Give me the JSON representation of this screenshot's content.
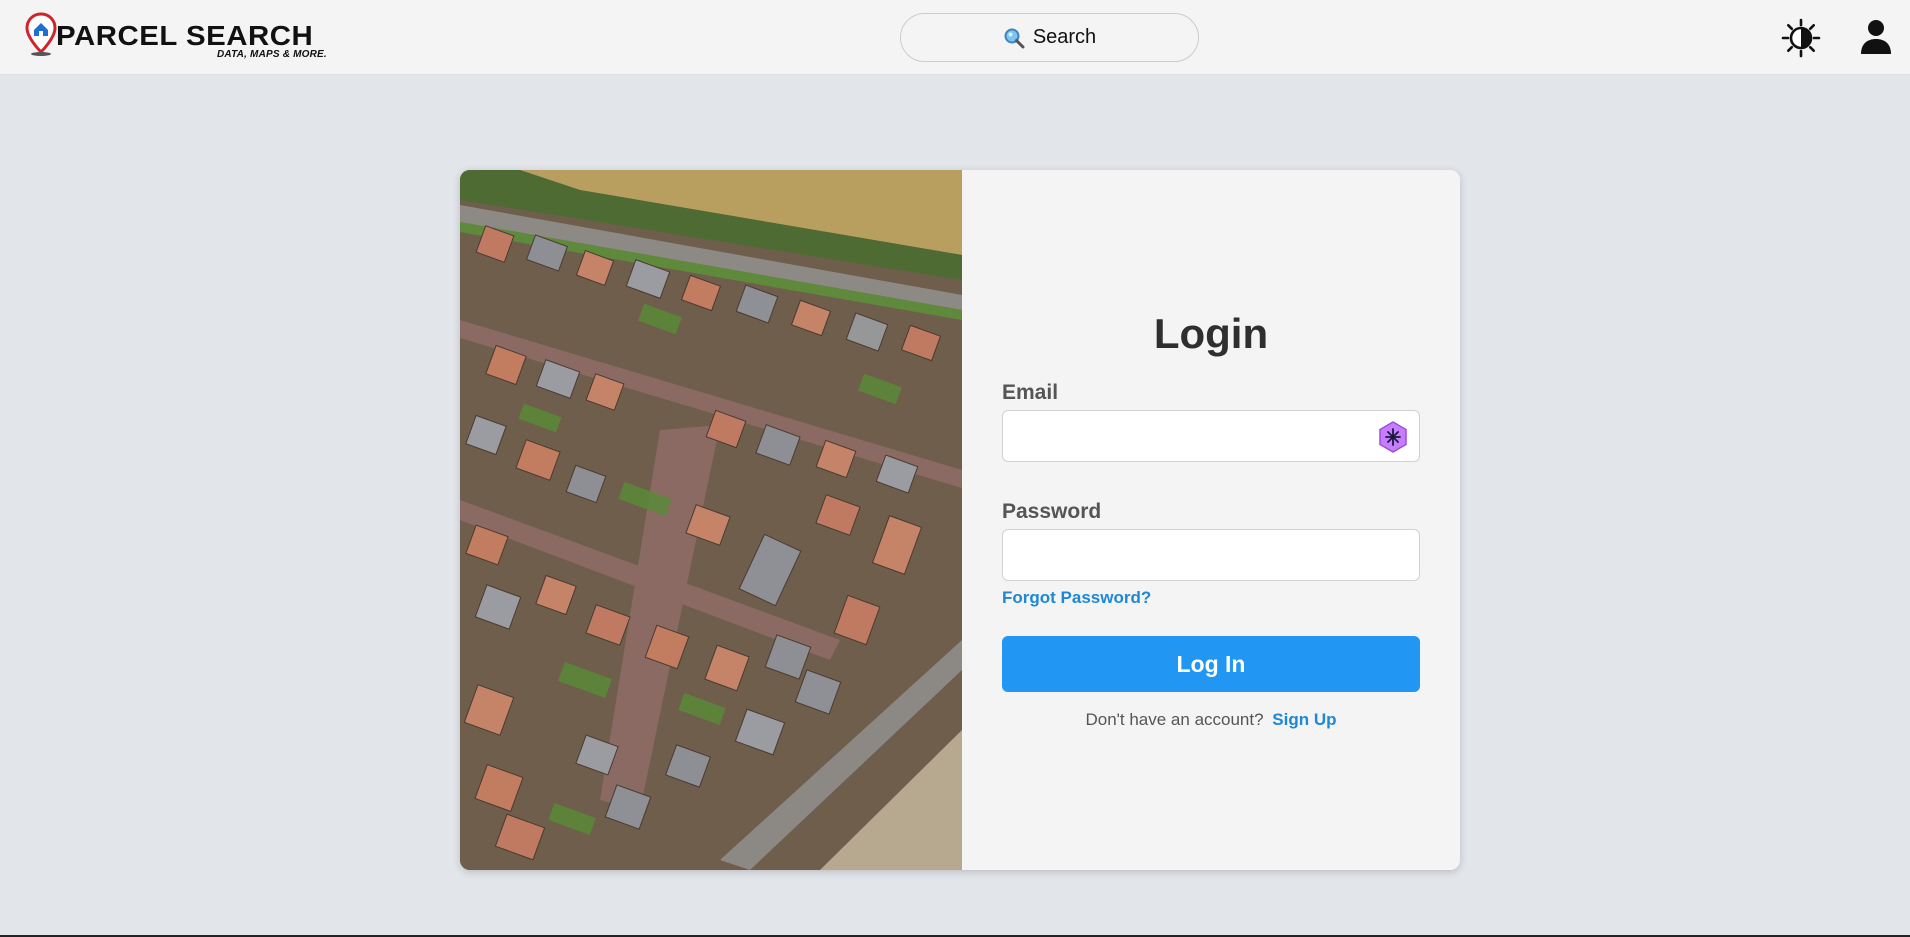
{
  "header": {
    "logo_title": "PARCEL SEARCH",
    "logo_tagline": "DATA, MAPS & MORE.",
    "search_label": "Search",
    "search_icon": "magnifier-icon",
    "theme_icon": "contrast-sun-icon",
    "account_icon": "user-icon"
  },
  "login": {
    "title": "Login",
    "email_label": "Email",
    "email_value": "",
    "password_label": "Password",
    "password_value": "",
    "forgot_password": "Forgot Password?",
    "submit_label": "Log In",
    "no_account_text": "Don't have an account?",
    "signup_link": "Sign Up"
  },
  "colors": {
    "accent": "#2196f3",
    "link": "#1e88d6",
    "page_bg": "#e2e5ea",
    "panel_bg": "#f4f4f4"
  }
}
